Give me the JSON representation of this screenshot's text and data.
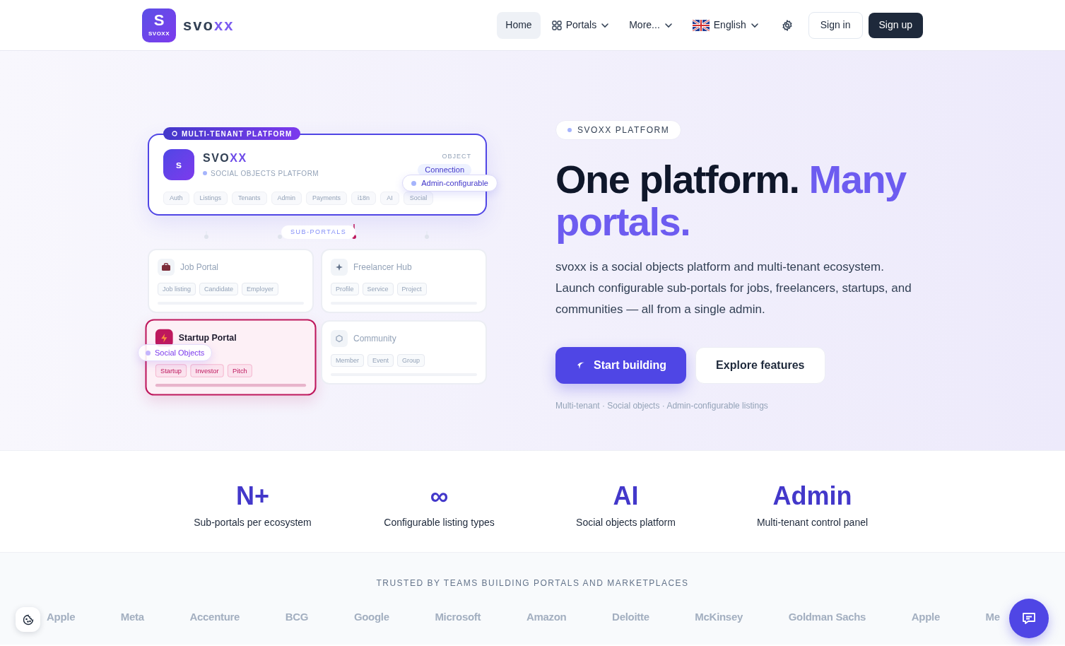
{
  "header": {
    "logo": {
      "letter": "S",
      "caption": "SVOXX"
    },
    "brand": {
      "dark": "svo",
      "accent": "xx"
    },
    "nav": [
      {
        "label": "Home",
        "kind": "link",
        "selected": true
      },
      {
        "label": "Portals",
        "kind": "grid-menu",
        "selected": false
      },
      {
        "label": "More...",
        "kind": "menu",
        "selected": false
      },
      {
        "label": "English",
        "kind": "language",
        "selected": false
      }
    ],
    "sign_in": "Sign in",
    "sign_up": "Sign up"
  },
  "diagram": {
    "badge": "MULTI-TENANT PLATFORM",
    "core": {
      "letter": "s",
      "name": {
        "dark": "SVO",
        "accent": "XX"
      },
      "subtitle": "SOCIAL OBJECTS PLATFORM",
      "object_label": "OBJECT",
      "object_value": "Connection",
      "tags": [
        "Auth",
        "Listings",
        "Tenants",
        "Admin",
        "Payments",
        "i18n",
        "AI",
        "Social"
      ]
    },
    "core_note": "Admin-configurable",
    "connector_label": "SUB-PORTALS",
    "portals": [
      {
        "name": "Job Portal",
        "tags": [
          "Job listing",
          "Candidate",
          "Employer"
        ],
        "selected": false
      },
      {
        "name": "Freelancer Hub",
        "tags": [
          "Profile",
          "Service",
          "Project"
        ],
        "selected": false
      },
      {
        "name": "Startup Portal",
        "tags": [
          "Startup",
          "Investor",
          "Pitch"
        ],
        "selected": true
      },
      {
        "name": "Community",
        "tags": [
          "Member",
          "Event",
          "Group"
        ],
        "selected": false
      }
    ],
    "portal_note": "Social Objects"
  },
  "hero": {
    "eyebrow": "SVOXX PLATFORM",
    "headline": "One platform.",
    "headline_accent": "Many portals.",
    "description": "svoxx is a social objects platform and multi-tenant ecosystem. Launch configurable sub-portals for jobs, freelancers, startups, and communities — all from a single admin.",
    "primary_button": "Start building",
    "secondary_button": "Explore features",
    "footnote": "Multi-tenant · Social objects · Admin-configurable listings"
  },
  "stats": [
    {
      "value": "N+",
      "label": "Sub-portals per ecosystem"
    },
    {
      "value": "∞",
      "label": "Configurable listing types"
    },
    {
      "value": "AI",
      "label": "Social objects platform"
    },
    {
      "value": "Admin",
      "label": "Multi-tenant control panel"
    }
  ],
  "trusted": {
    "title": "TRUSTED BY TEAMS BUILDING PORTALS AND MARKETPLACES",
    "logos": [
      "Apple",
      "Meta",
      "Accenture",
      "BCG",
      "Google",
      "Microsoft",
      "Amazon",
      "Deloitte",
      "McKinsey",
      "Goldman Sachs",
      "Apple",
      "Me"
    ]
  }
}
